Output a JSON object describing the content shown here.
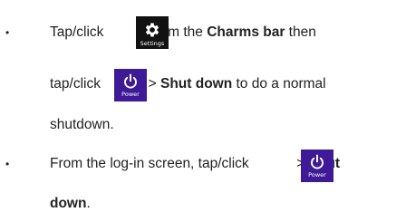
{
  "bullets": [
    {
      "symbol": "•",
      "line1": {
        "pre": "Tap/click ",
        "icon": "gear-icon",
        "icon_caption": "Settings",
        "mid": " from  the ",
        "bold": "Charms bar",
        "post": " then"
      },
      "line2": {
        "pre": "tap/click ",
        "icon": "power-icon",
        "icon_caption": "Power",
        "mid": " > ",
        "bold": "Shut down",
        "post": " to do a normal"
      },
      "line3": {
        "text": "shutdown."
      }
    },
    {
      "symbol": "•",
      "line1": {
        "pre": "From the log-in screen, tap/click ",
        "icon": "power-icon",
        "icon_caption": "Power",
        "mid": " > ",
        "bold": "Shut"
      },
      "line2": {
        "bold": "down",
        "post": "."
      }
    }
  ],
  "colors": {
    "settings_tile": "#111111",
    "power_tile": "#3f1a96",
    "text": "#222222"
  }
}
